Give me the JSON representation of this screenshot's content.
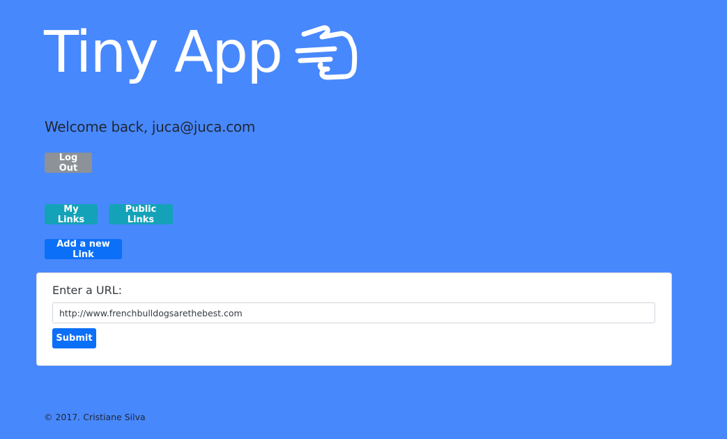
{
  "header": {
    "title": "Tiny App",
    "icon": "pointing-hand-icon"
  },
  "welcome": {
    "text": "Welcome back, juca@juca.com"
  },
  "buttons": {
    "logout": "Log Out",
    "my_links": "My Links",
    "public_links": "Public Links",
    "add_link": "Add a new Link"
  },
  "form": {
    "label": "Enter a URL:",
    "url_value": "http://www.frenchbulldogsarethebest.com",
    "submit": "Submit"
  },
  "footer": {
    "text": "© 2017. Cristiane Silva"
  },
  "colors": {
    "background": "#4888fd",
    "secondary_button": "#8c9298",
    "info_button": "#14a2b8",
    "primary_button": "#0c6ff7"
  }
}
